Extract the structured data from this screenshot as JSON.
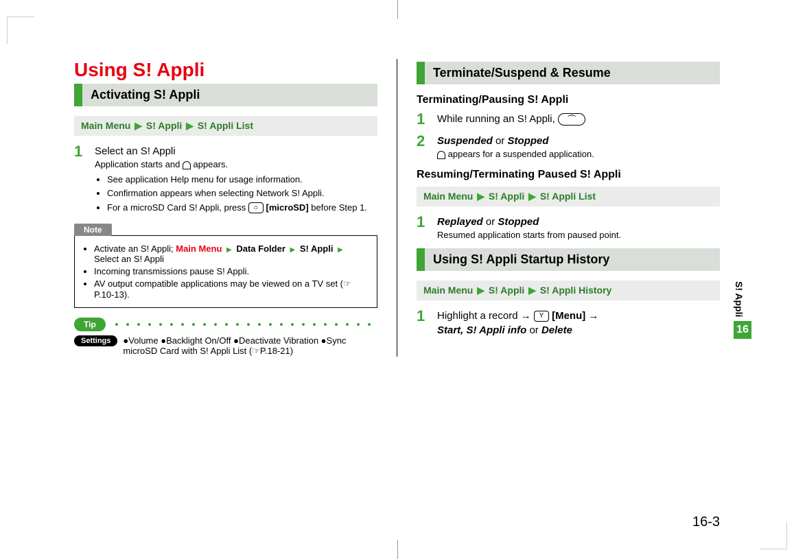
{
  "page": {
    "number": "16-3",
    "sideLabel": "S! Appli",
    "sideNum": "16"
  },
  "left": {
    "title": "Using S! Appli",
    "section": "Activating S! Appli",
    "nav": [
      "Main Menu",
      "S! Appli",
      "S! Appli List"
    ],
    "step1": {
      "text": "Select an S! Appli",
      "sub": "Application starts and",
      "sub2": "appears.",
      "bullets": [
        "See application Help menu for usage information.",
        "Confirmation appears when selecting Network S! Appli.",
        "For a microSD Card S! Appli, press ",
        "[microSD]",
        " before Step 1."
      ]
    },
    "noteLabel": "Note",
    "note": {
      "item1a": "Activate an S! Appli; ",
      "item1b": "Main Menu",
      "item1c": "Data Folder",
      "item1d": "S! Appli",
      "item1e": "Select an S! Appli",
      "item2": "Incoming transmissions pause S! Appli.",
      "item3": "AV output compatible applications may be viewed on a TV set (☞P.10-13)."
    },
    "tipLabel": "Tip",
    "settingsLabel": "Settings",
    "settingsText": "●Volume ●Backlight On/Off ●Deactivate Vibration ●Sync microSD Card with S! Appli List (☞P.18-21)"
  },
  "right": {
    "section1": "Terminate/Suspend & Resume",
    "sub1": "Terminating/Pausing S! Appli",
    "step1": "While running an S! Appli,",
    "step2a": "Suspended",
    "step2b": " or ",
    "step2c": "Stopped",
    "step2sub": "appears for a suspended application.",
    "sub2": "Resuming/Terminating Paused S! Appli",
    "nav2": [
      "Main Menu",
      "S! Appli",
      "S! Appli List"
    ],
    "s2step1a": "Replayed",
    "s2step1b": " or ",
    "s2step1c": "Stopped",
    "s2step1sub": "Resumed application starts from paused point.",
    "section2": "Using S! Appli Startup History",
    "nav3": [
      "Main Menu",
      "S! Appli",
      "S! Appli History"
    ],
    "h1a": "Highlight a record → ",
    "h1b": "[Menu]",
    "h1c": " →",
    "h2a": "Start, S! Appli info",
    "h2b": " or ",
    "h2c": "Delete"
  }
}
